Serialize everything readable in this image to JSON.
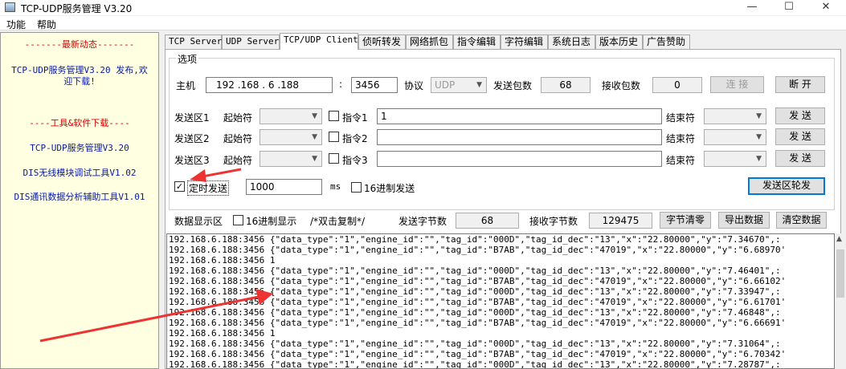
{
  "window": {
    "title": "TCP-UDP服务管理 V3.20",
    "minimize": "—",
    "maximize": "☐",
    "close": "✕"
  },
  "menu": [
    "功能",
    "帮助"
  ],
  "left_panel": {
    "news_header": "-------最新动态-------",
    "news_body": "TCP-UDP服务管理V3.20 发布,欢迎下载!",
    "tools_header": "----工具&软件下载----",
    "tools": [
      "TCP-UDP服务管理V3.20",
      "DIS无线模块调试工具V1.02",
      "DIS通讯数据分析辅助工具V1.01"
    ]
  },
  "tabs": [
    "TCP Server",
    "UDP Server",
    "TCP/UDP Client",
    "侦听转发",
    "网络抓包",
    "指令编辑",
    "字符编辑",
    "系统日志",
    "版本历史",
    "广告赞助"
  ],
  "options": {
    "group_title": "选项",
    "host_label": "主机",
    "host_ip": "192 .168 . 6 .188",
    "colon": ":",
    "port": "3456",
    "protocol_label": "协议",
    "protocol": "UDP",
    "sent_packets_label": "发送包数",
    "sent_packets": "68",
    "recv_packets_label": "接收包数",
    "recv_packets": "0",
    "connect_label": "连 接",
    "disconnect_label": "断 开"
  },
  "send_areas": [
    {
      "label": "发送区1",
      "start_label": "起始符",
      "cmd_label": "指令1",
      "content": "1",
      "end_label": "结束符",
      "send_label": "发 送"
    },
    {
      "label": "发送区2",
      "start_label": "起始符",
      "cmd_label": "指令2",
      "content": "",
      "end_label": "结束符",
      "send_label": "发 送"
    },
    {
      "label": "发送区3",
      "start_label": "起始符",
      "cmd_label": "指令3",
      "content": "",
      "end_label": "结束符",
      "send_label": "发 送"
    }
  ],
  "timer": {
    "label": "定时发送",
    "checked_mark": "✓",
    "interval": "1000",
    "unit": "ms",
    "hex_send_label": "16进制发送",
    "rotate_label": "发送区轮发"
  },
  "display": {
    "label": "数据显示区",
    "hex_display_label": "16进制显示",
    "hint": "/*双击复制*/",
    "sent_bytes_label": "发送字节数",
    "sent_bytes": "68",
    "recv_bytes_label": "接收字节数",
    "recv_bytes": "129475",
    "clear_bytes": "字节清零",
    "export": "导出数据",
    "clear_data": "清空数据"
  },
  "log_lines": [
    "192.168.6.188:3456 {\"data_type\":\"1\",\"engine_id\":\"\",\"tag_id\":\"000D\",\"tag_id_dec\":\"13\",\"x\":\"22.80000\",\"y\":\"7.34670\",:",
    "192.168.6.188:3456 {\"data_type\":\"1\",\"engine_id\":\"\",\"tag_id\":\"B7AB\",\"tag_id_dec\":\"47019\",\"x\":\"22.80000\",\"y\":\"6.68970'",
    "192.168.6.188:3456 1",
    "192.168.6.188:3456 {\"data_type\":\"1\",\"engine_id\":\"\",\"tag_id\":\"000D\",\"tag_id_dec\":\"13\",\"x\":\"22.80000\",\"y\":\"7.46401\",:",
    "192.168.6.188:3456 {\"data_type\":\"1\",\"engine_id\":\"\",\"tag_id\":\"B7AB\",\"tag_id_dec\":\"47019\",\"x\":\"22.80000\",\"y\":\"6.66102'",
    "192.168.6.188:3456 {\"data_type\":\"1\",\"engine_id\":\"\",\"tag_id\":\"000D\",\"tag_id_dec\":\"13\",\"x\":\"22.80000\",\"y\":\"7.33947\",:",
    "192.168.6.188:3456 {\"data_type\":\"1\",\"engine_id\":\"\",\"tag_id\":\"B7AB\",\"tag_id_dec\":\"47019\",\"x\":\"22.80000\",\"y\":\"6.61701'",
    "192.168.6.188:3456 {\"data_type\":\"1\",\"engine_id\":\"\",\"tag_id\":\"000D\",\"tag_id_dec\":\"13\",\"x\":\"22.80000\",\"y\":\"7.46848\",:",
    "192.168.6.188:3456 {\"data_type\":\"1\",\"engine_id\":\"\",\"tag_id\":\"B7AB\",\"tag_id_dec\":\"47019\",\"x\":\"22.80000\",\"y\":\"6.66691'",
    "192.168.6.188:3456 1",
    "192.168.6.188:3456 {\"data_type\":\"1\",\"engine_id\":\"\",\"tag_id\":\"000D\",\"tag_id_dec\":\"13\",\"x\":\"22.80000\",\"y\":\"7.31064\",:",
    "192.168.6.188:3456 {\"data_type\":\"1\",\"engine_id\":\"\",\"tag_id\":\"B7AB\",\"tag_id_dec\":\"47019\",\"x\":\"22.80000\",\"y\":\"6.70342'",
    "192.168.6.188:3456 {\"data_type\":\"1\",\"engine_id\":\"\",\"tag_id\":\"000D\",\"tag_id_dec\":\"13\",\"x\":\"22.80000\",\"y\":\"7.28787\",:"
  ],
  "icons": {
    "dropdown": "▼",
    "scroll_up": "▲"
  },
  "colors": {
    "left_panel_bg": "#ffffe1",
    "red_text": "#d40000",
    "blue_text": "#0a1aa0",
    "annotation_arrow": "#ee3333",
    "focus_border": "#0078d7"
  }
}
